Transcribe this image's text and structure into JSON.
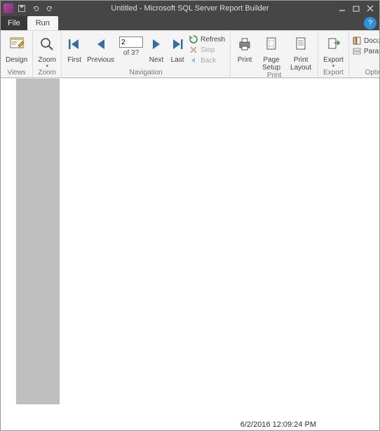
{
  "title": "Untitled - Microsoft SQL Server Report Builder",
  "tabs": {
    "file": "File",
    "run": "Run"
  },
  "ribbon": {
    "views": {
      "group": "Views",
      "design": "Design"
    },
    "zoom": {
      "group": "Zoom",
      "zoom": "Zoom"
    },
    "navigation": {
      "group": "Navigation",
      "first": "First",
      "previous": "Previous",
      "next": "Next",
      "last": "Last",
      "page_value": "2",
      "page_of": "of 3?",
      "refresh": "Refresh",
      "stop": "Stop",
      "back": "Back"
    },
    "print": {
      "group": "Print",
      "print": "Print",
      "page_setup": "Page\nSetup",
      "print_layout": "Print\nLayout"
    },
    "export": {
      "group": "Export",
      "export": "Export"
    },
    "options": {
      "group": "Options",
      "document": "Document",
      "parameters": "Parameters"
    }
  },
  "timestamp": "6/2/2016 12:09:24 PM",
  "colors": {
    "accent": "#2f6fb0",
    "titlebar": "#464646"
  }
}
